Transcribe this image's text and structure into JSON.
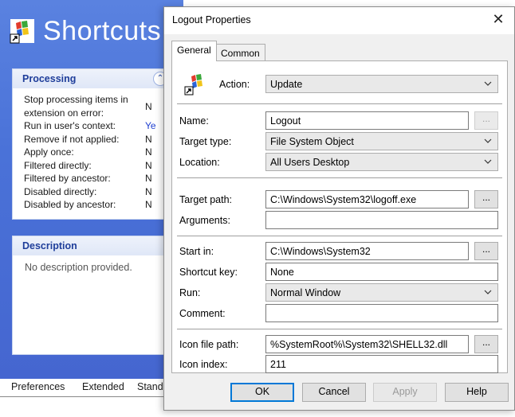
{
  "background": {
    "title": "Shortcuts",
    "processing": {
      "header": "Processing",
      "rows": [
        {
          "label": "Stop processing items in extension on error:",
          "value": "N"
        },
        {
          "label": "Run in user's context:",
          "value": "Ye"
        },
        {
          "label": "Remove if not applied:",
          "value": "N"
        },
        {
          "label": "Apply once:",
          "value": "N"
        },
        {
          "label": "Filtered directly:",
          "value": "N"
        },
        {
          "label": "Filtered by ancestor:",
          "value": "N"
        },
        {
          "label": "Disabled directly:",
          "value": "N"
        },
        {
          "label": "Disabled by ancestor:",
          "value": "N"
        }
      ]
    },
    "description": {
      "header": "Description",
      "text": "No description provided."
    },
    "tabs": [
      "Preferences",
      "Extended",
      "Stand"
    ]
  },
  "dialog": {
    "title": "Logout Properties",
    "close_glyph": "✕",
    "tabs": {
      "general": "General",
      "common": "Common"
    },
    "action": {
      "label": "Action:",
      "value": "Update"
    },
    "name": {
      "label": "Name:",
      "value": "Logout",
      "browse": "..."
    },
    "target_type": {
      "label": "Target type:",
      "value": "File System Object"
    },
    "location": {
      "label": "Location:",
      "value": "All Users Desktop"
    },
    "target_path": {
      "label": "Target path:",
      "value": "C:\\Windows\\System32\\logoff.exe",
      "browse": "..."
    },
    "arguments": {
      "label": "Arguments:",
      "value": ""
    },
    "start_in": {
      "label": "Start in:",
      "value": "C:\\Windows\\System32",
      "browse": "..."
    },
    "shortcut_key": {
      "label": "Shortcut key:",
      "value": "None"
    },
    "run": {
      "label": "Run:",
      "value": "Normal Window"
    },
    "comment": {
      "label": "Comment:",
      "value": ""
    },
    "icon_file_path": {
      "label": "Icon file path:",
      "value": "%SystemRoot%\\System32\\SHELL32.dll",
      "browse": "..."
    },
    "icon_index": {
      "label": "Icon index:",
      "value": "211"
    },
    "buttons": {
      "ok": "OK",
      "cancel": "Cancel",
      "apply": "Apply",
      "help": "Help"
    }
  },
  "icons": [
    "shortcut-header-icon",
    "collapse-icon",
    "action-shortcut-icon",
    "close-icon",
    "chevron-down-icon"
  ],
  "colors": {
    "pane_blue": "#4a72d8",
    "header_text": "#1f3e9a",
    "default_button_border": "#0078d7"
  }
}
